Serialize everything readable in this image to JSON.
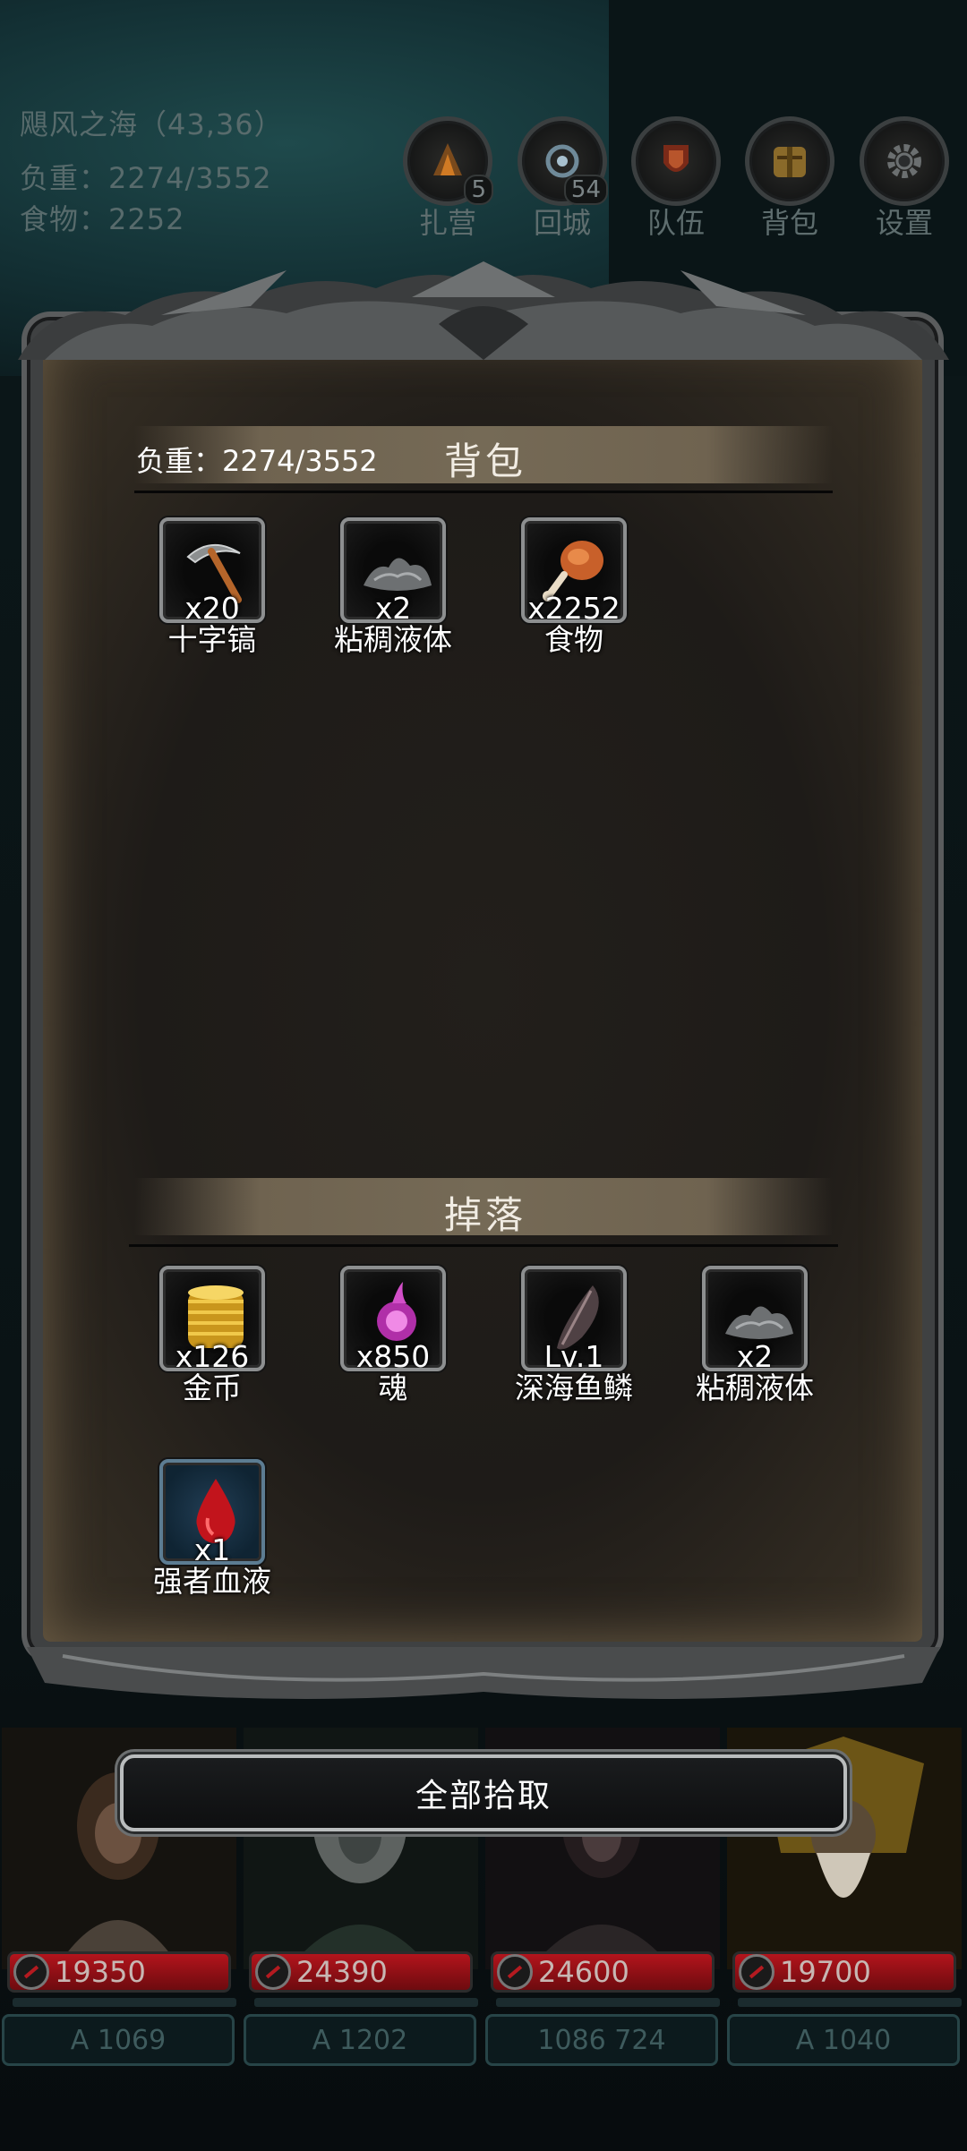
{
  "hud": {
    "location": "飓风之海（43,36）",
    "load": "负重：2274/3552",
    "food": "食物：2252",
    "buttons": [
      {
        "icon": "camp-icon",
        "label": "扎营",
        "count": "5"
      },
      {
        "icon": "return-city-icon",
        "label": "回城",
        "count": "54"
      },
      {
        "icon": "team-icon",
        "label": "队伍",
        "count": ""
      },
      {
        "icon": "backpack-icon",
        "label": "背包",
        "count": ""
      },
      {
        "icon": "gear-icon",
        "label": "设置",
        "count": ""
      }
    ]
  },
  "backpack": {
    "title": "背包",
    "load": "负重：2274/3552",
    "items": [
      {
        "icon": "pickaxe-icon",
        "qty": "x20",
        "name": "十字镐"
      },
      {
        "icon": "slime-icon",
        "qty": "x2",
        "name": "粘稠液体"
      },
      {
        "icon": "meat-icon",
        "qty": "x2252",
        "name": "食物"
      }
    ]
  },
  "drops": {
    "title": "掉落",
    "items": [
      {
        "icon": "gold-coins-icon",
        "qty": "x126",
        "name": "金币"
      },
      {
        "icon": "soul-icon",
        "qty": "x850",
        "name": "魂"
      },
      {
        "icon": "fish-scale-icon",
        "qty": "Lv.1",
        "name": "深海鱼鳞"
      },
      {
        "icon": "slime-icon",
        "qty": "x2",
        "name": "粘稠液体"
      },
      {
        "icon": "blood-drop-icon",
        "qty": "x1",
        "name": "强者血液"
      }
    ]
  },
  "pickup_all": "全部拾取",
  "heroes": [
    {
      "hp": "19350",
      "stat": "A 1069"
    },
    {
      "hp": "24390",
      "stat": "A 1202"
    },
    {
      "hp": "24600",
      "stat": "1086 724"
    },
    {
      "hp": "19700",
      "stat": "A 1040"
    }
  ]
}
